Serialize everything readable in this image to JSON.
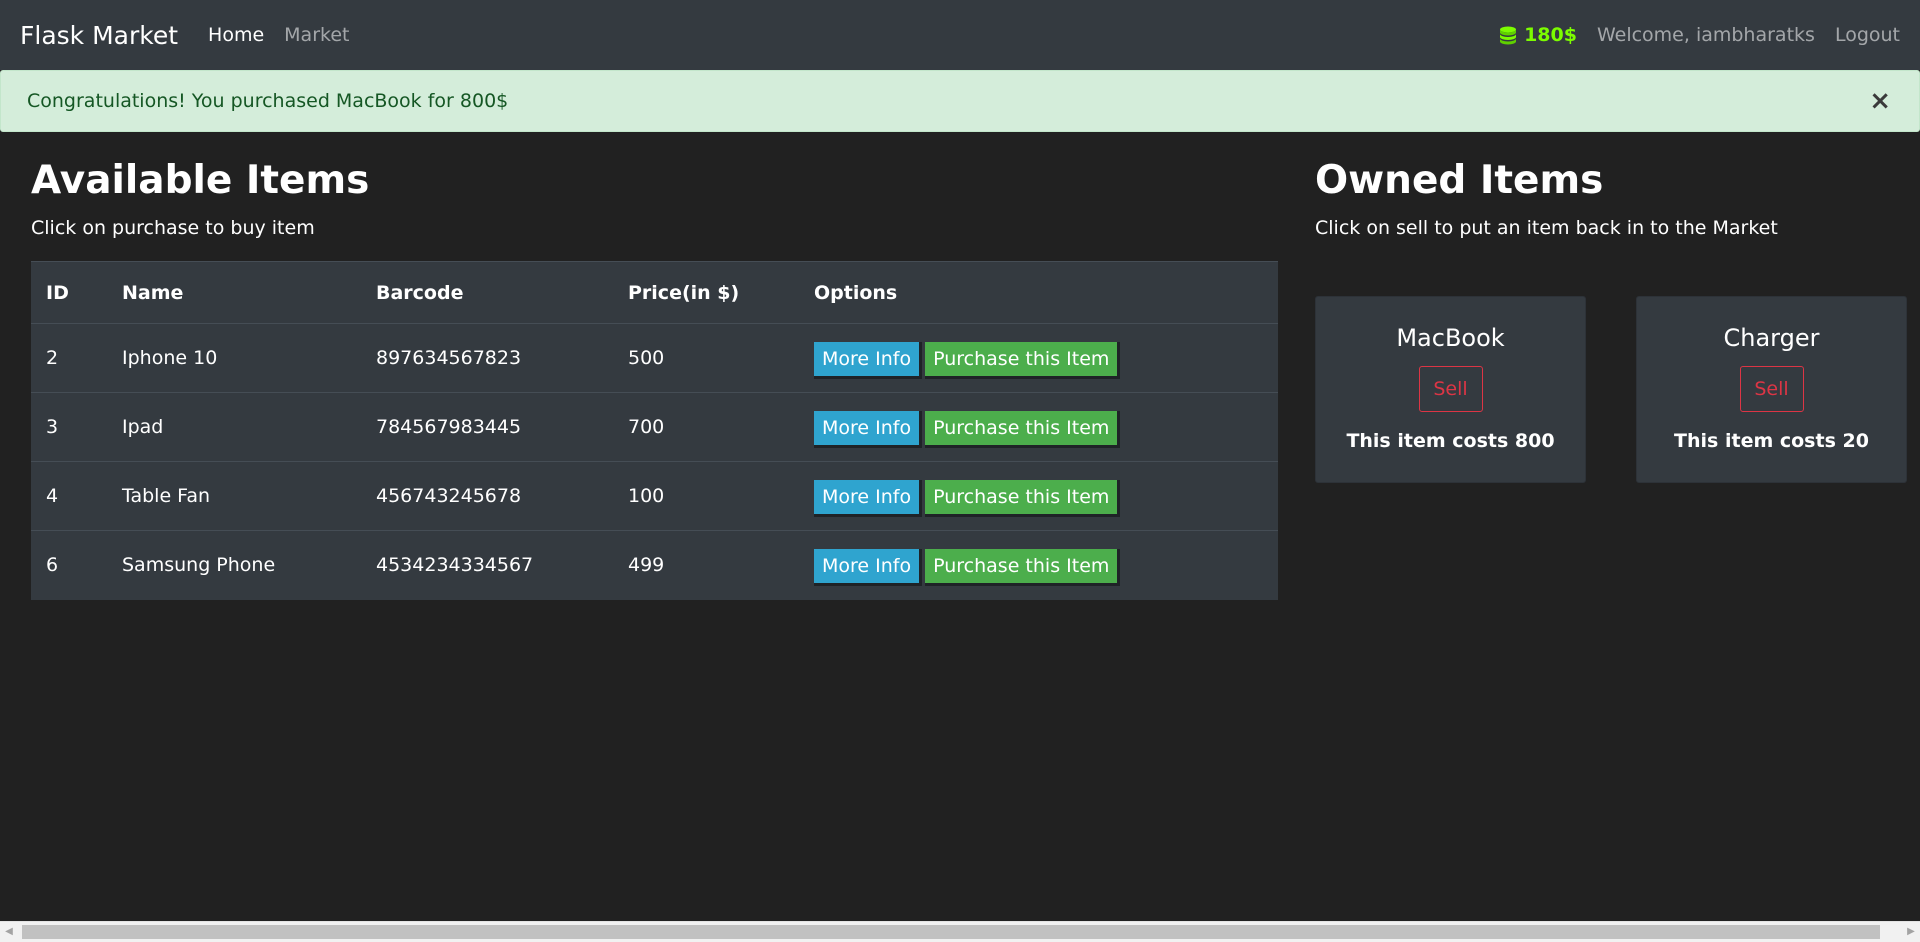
{
  "navbar": {
    "brand": "Flask Market",
    "links": [
      {
        "label": "Home",
        "active": true
      },
      {
        "label": "Market",
        "active": false
      }
    ],
    "budget": "180$",
    "budget_icon": "coins-icon",
    "budget_color": "#7cfc00",
    "welcome": "Welcome, iambharatks",
    "logout": "Logout"
  },
  "alert": {
    "message": "Congratulations! You purchased MacBook for 800$",
    "close": "×"
  },
  "available": {
    "title": "Available Items",
    "subtitle": "Click on purchase to buy item",
    "columns": [
      "ID",
      "Name",
      "Barcode",
      "Price(in $)",
      "Options"
    ],
    "rows": [
      {
        "id": "2",
        "name": "Iphone 10",
        "barcode": "897634567823",
        "price": "500",
        "info": "More Info",
        "purchase": "Purchase this Item"
      },
      {
        "id": "3",
        "name": "Ipad",
        "barcode": "784567983445",
        "price": "700",
        "info": "More Info",
        "purchase": "Purchase this Item"
      },
      {
        "id": "4",
        "name": "Table Fan",
        "barcode": "456743245678",
        "price": "100",
        "info": "More Info",
        "purchase": "Purchase this Item"
      },
      {
        "id": "6",
        "name": "Samsung Phone",
        "barcode": "4534234334567",
        "price": "499",
        "info": "More Info",
        "purchase": "Purchase this Item"
      }
    ]
  },
  "owned": {
    "title": "Owned Items",
    "subtitle": "Click on sell to put an item back in to the Market",
    "items": [
      {
        "name": "MacBook",
        "sell": "Sell",
        "cost": "This item costs 800"
      },
      {
        "name": "Charger",
        "sell": "Sell",
        "cost": "This item costs 20"
      }
    ]
  },
  "colors": {
    "background": "#212121",
    "navbar": "#343a40",
    "alert_bg": "#d4edda",
    "info_button": "#2fa4cf",
    "success_button": "#4cae4c",
    "sell_outline": "#dc3545"
  }
}
